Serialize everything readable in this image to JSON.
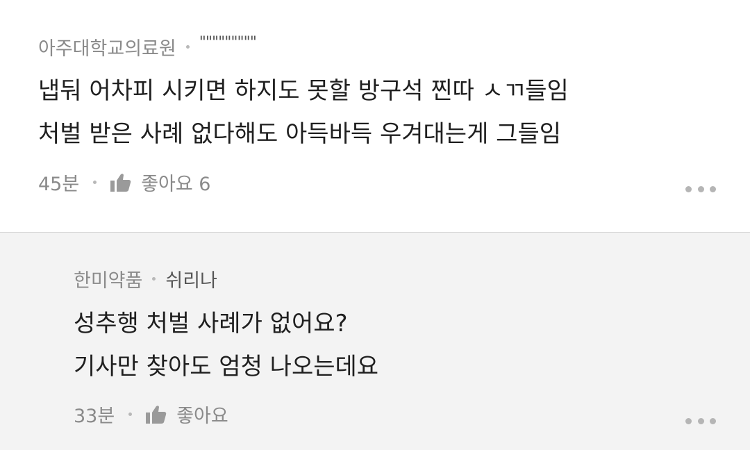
{
  "comments": [
    {
      "author": "아주대학교의료원",
      "nickname": "\"\"\"\"\"\"\"\"\"",
      "lines": [
        "냅둬 어차피 시키면 하지도 못할 방구석 찐따 ㅅㄲ들임",
        "처벌 받은 사례 없다해도 아득바득 우겨대는게 그들임"
      ],
      "time": "45분",
      "like_label": "좋아요 6"
    },
    {
      "author": "한미약품",
      "nickname": "쉬리나",
      "lines": [
        "성추행 처벌 사례가 없어요?",
        "기사만 찾아도 엄청 나오는데요"
      ],
      "time": "33분",
      "like_label": "좋아요"
    }
  ],
  "icons": {
    "like": "thumbs-up-icon",
    "more": "more-horizontal-icon"
  },
  "colors": {
    "reply_background": "#f3f3f3",
    "meta_text": "#8a8a8a",
    "body_text": "#1f1f1f"
  }
}
